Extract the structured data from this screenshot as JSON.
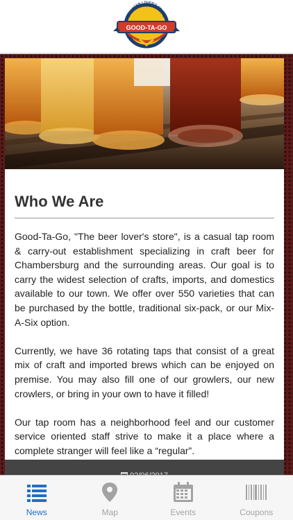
{
  "header": {
    "logo_text": "GOOD-TA-GO",
    "logo_tagline": "THE BEER LOVER'S STORE"
  },
  "article": {
    "title": "Who We Are",
    "paragraphs": [
      "Good-Ta-Go, \"The beer lover's store\", is a casual tap room & carry-out establishment specializing in craft beer for Chambersburg and the surrounding areas. Our goal is to carry the widest selection of crafts, imports, and domestics available to our town. We offer over 550 varieties that can be purchased by the bottle, traditional six-pack, or our Mix-A-Six option.",
      "Currently, we have 36 rotating taps that consist of a great mix of craft and imported brews which can be enjoyed on premise. You may also fill one of our growlers, our new crowlers, or bring in your own to have it filled!",
      "Our tap room has a neighborhood feel and our customer service oriented staff strive to make it a place where a complete stranger will feel like a “regular”."
    ],
    "date": "02/06/2017"
  },
  "tabbar": {
    "tabs": [
      {
        "label": "News",
        "icon": "list-icon",
        "active": true
      },
      {
        "label": "Map",
        "icon": "map-pin-icon",
        "active": false
      },
      {
        "label": "Events",
        "icon": "calendar-icon",
        "active": false
      },
      {
        "label": "Coupons",
        "icon": "barcode-icon",
        "active": false
      }
    ],
    "active_color": "#1f6fc6",
    "inactive_color": "#a3a3a3"
  }
}
